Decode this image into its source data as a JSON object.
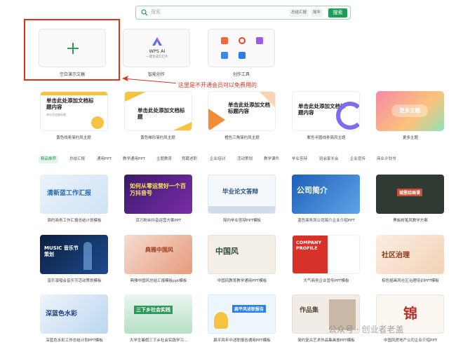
{
  "search": {
    "placeholder": "搜索",
    "chips": [
      "总结汇报",
      "简年"
    ],
    "button": "搜索"
  },
  "top_tiles": [
    {
      "label": "空白演示文稿"
    },
    {
      "label": "智能创作",
      "logo_title": "WPS AI",
      "logo_sub": "一键生成幻灯片"
    },
    {
      "label": "创作工具"
    }
  ],
  "annotation": "这里是不开通会员可以免费用的",
  "theme_cards": [
    {
      "label": "黄色线条简约风主题",
      "title": "单击此处添加文档标题内容",
      "sub": "单击添加副标题"
    },
    {
      "label": "黄色梯形简约风主题",
      "title": "单击此处添加文档标题",
      "sub": ""
    },
    {
      "label": "橙色三角简约风主题",
      "title": "单击此处添加文档标题内容",
      "sub": ""
    },
    {
      "label": "紫色半圆线条简风主题",
      "title": "单击此处添加文档标题内容",
      "sub": ""
    },
    {
      "label": "更多主题",
      "title": "更多主题",
      "sub": ""
    }
  ],
  "tabs": [
    "精品推荐",
    "总结汇报",
    "通用PPT",
    "教学通用PPT",
    "主题教育",
    "竞聘述职",
    "企业培训",
    "活动策划",
    "教学课件",
    "毕业答辩",
    "班会家长会",
    "企业宣传",
    "商业计划书"
  ],
  "grid_row1": [
    {
      "label": "简约商务工作汇报总结计划模板",
      "text": "清新蓝工作汇报"
    },
    {
      "label": "百万粉丝抖音运营方案PPT",
      "text": "如何从零运营好一个百万抖音号"
    },
    {
      "label": "简约毕业答辩PPT模板",
      "text": "毕业论文答辩"
    },
    {
      "label": "蓝色商务风公司简介企业介绍PPT",
      "text": "公司简介"
    },
    {
      "label": "黑板粉笔风教学方案",
      "text": "城堡绘画课"
    }
  ],
  "grid_row2": [
    {
      "label": "音乐演唱会音乐节活动策划模板",
      "text": "MUSIC 音乐节策划"
    },
    {
      "label": "典雅中国风总结汇报模板ppt模板",
      "text": "典雅中国风"
    },
    {
      "label": "中国风教育教学通用PPT模板",
      "text": "中国风"
    },
    {
      "label": "大气商务企业宣传PPT模板",
      "text": "COMPANY PROFILE"
    },
    {
      "label": "棕色插画风社区治理培训PPT模板",
      "text": "社区治理"
    }
  ],
  "grid_row3": [
    {
      "label": "深蓝色水彩工作总结计划PPT模板",
      "text": "深蓝色水彩"
    },
    {
      "label": "大学生暑假三下乡社会实践学习...",
      "text": "三下乡社会实践"
    },
    {
      "label": "扁平风年中述职报告通用PPT模板",
      "text": "扁平风述职报告"
    },
    {
      "label": "简约复古艺术作品集画册PPT模板",
      "text": "作品集"
    },
    {
      "label": "中国风房地产公司企业介绍PPT",
      "text": "锦"
    }
  ],
  "watermark": "公众号 · 创业者老盖",
  "colors": {
    "accent": "#1f9d58",
    "annotation": "#e0301e"
  }
}
